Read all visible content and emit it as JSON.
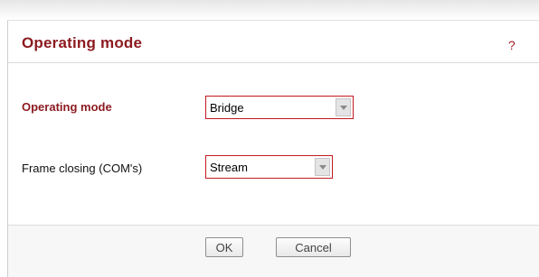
{
  "panel": {
    "title": "Operating mode",
    "help_label": "?"
  },
  "form": {
    "operating_mode": {
      "label": "Operating mode",
      "selected": "Bridge"
    },
    "frame_closing": {
      "label": "Frame closing (COM's)",
      "selected": "Stream"
    }
  },
  "buttons": {
    "ok_label": "OK",
    "cancel_label": "Cancel"
  },
  "colors": {
    "title": "#8c1a1f",
    "select_border": "#c41a22"
  },
  "icons": {
    "dropdown": "chevron-down-icon"
  }
}
